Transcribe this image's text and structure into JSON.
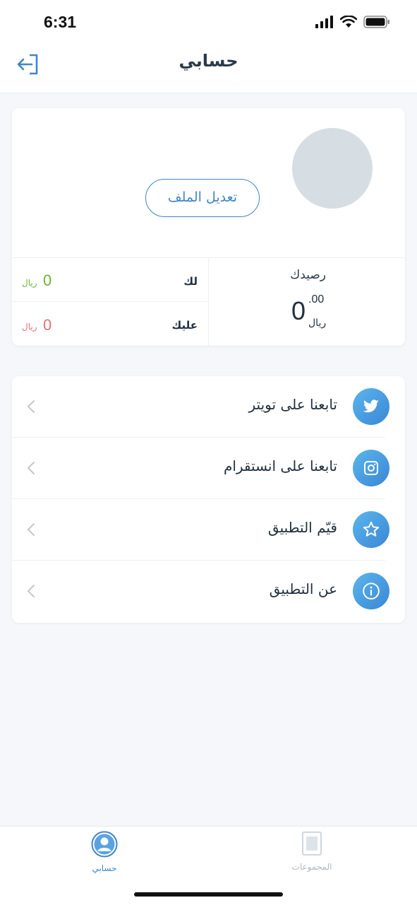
{
  "status_bar": {
    "time": "6:31"
  },
  "header": {
    "title": "حسابي"
  },
  "profile": {
    "edit_button": "تعديل الملف",
    "balance_label": "رصيدك",
    "balance_integer": "0",
    "balance_decimal": ".00",
    "balance_currency": "ريال",
    "rows": [
      {
        "label": "لك",
        "amount": "0",
        "currency": "ريال",
        "color": "#6ab531"
      },
      {
        "label": "عليك",
        "amount": "0",
        "currency": "ريال",
        "color": "#e0717a"
      }
    ]
  },
  "menu": {
    "items": [
      {
        "label": "تابعنا على تويتر",
        "icon": "twitter-icon"
      },
      {
        "label": "تابعنا على انستقرام",
        "icon": "instagram-icon"
      },
      {
        "label": "قيّم التطبيق",
        "icon": "star-icon"
      },
      {
        "label": "عن التطبيق",
        "icon": "info-icon"
      }
    ]
  },
  "tabbar": {
    "tabs": [
      {
        "label": "حسابي",
        "icon": "user-icon",
        "active": true
      },
      {
        "label": "المجموعات",
        "icon": "document-icon",
        "active": false
      }
    ]
  },
  "colors": {
    "accent": "#3f86c8",
    "positive": "#6ab531",
    "negative": "#e0717a"
  }
}
